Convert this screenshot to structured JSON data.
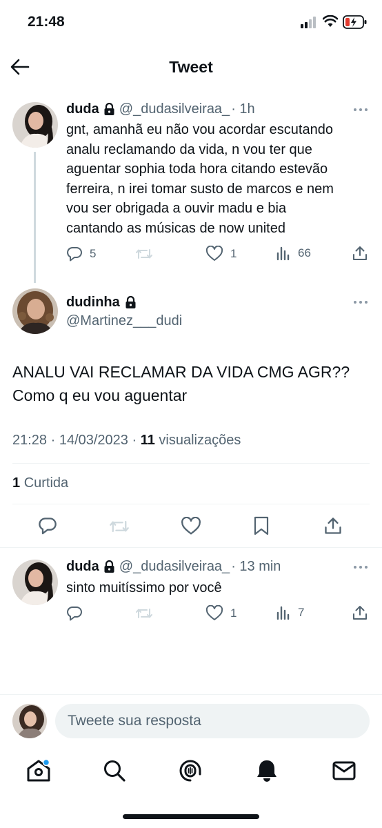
{
  "status_bar": {
    "time": "21:48"
  },
  "header": {
    "title": "Tweet"
  },
  "parent_tweet": {
    "name": "duda",
    "handle": "@_dudasilveiraa_",
    "time": "· 1h",
    "lines": [
      "gnt, amanhã eu não vou acordar escutando",
      "analu reclamando da vida, n vou ter que",
      "aguentar sophia toda hora citando estevão",
      "ferreira, n irei tomar susto de marcos e nem",
      "vou ser obrigada a ouvir madu e bia",
      "cantando as músicas de now united"
    ],
    "replies": "5",
    "likes": "1",
    "views": "66"
  },
  "main_tweet": {
    "name": "dudinha",
    "handle": "@Martinez___dudi",
    "lines": [
      "ANALU VAI RECLAMAR DA VIDA CMG AGR??",
      "Como q eu vou aguentar"
    ],
    "timestamp": "21:28 · 14/03/2023 ·",
    "views_count": "11",
    "views_label": "visualizações",
    "likes_count": "1",
    "likes_label": "Curtida"
  },
  "reply_tweet": {
    "name": "duda",
    "handle": "@_dudasilveiraa_",
    "time": "· 13 min",
    "text": "sinto muitíssimo por você",
    "likes": "1",
    "views": "7"
  },
  "compose": {
    "placeholder": "Tweete sua resposta"
  },
  "colors": {
    "accent": "#1d9bf0",
    "text": "#0f1419",
    "muted": "#536471",
    "border": "#eff3f4"
  },
  "icons": {
    "back": "arrow-left-icon",
    "lock": "lock-icon",
    "more": "more-icon",
    "reply": "reply-icon",
    "retweet": "retweet-icon",
    "like": "heart-icon",
    "views": "views-icon",
    "share": "share-icon",
    "bookmark": "bookmark-icon",
    "home": "home-icon",
    "search": "search-icon",
    "spaces": "spaces-icon",
    "notifications": "bell-icon",
    "messages": "mail-icon"
  }
}
